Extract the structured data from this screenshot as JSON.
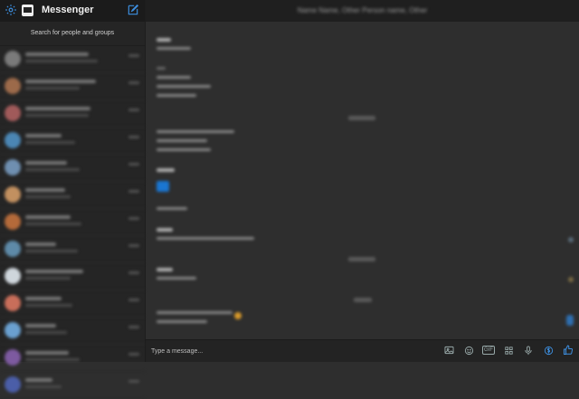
{
  "sidebar": {
    "title": "Messenger",
    "search_label": "Search for people and groups",
    "contacts": [
      {
        "avatar_color": "#7a7a7a",
        "name_w": 70,
        "prev_w": 80
      },
      {
        "avatar_color": "#9c6a4a",
        "name_w": 78,
        "prev_w": 60
      },
      {
        "avatar_color": "#a05a5a",
        "name_w": 72,
        "prev_w": 70
      },
      {
        "avatar_color": "#4b86b4",
        "name_w": 40,
        "prev_w": 55
      },
      {
        "avatar_color": "#6f8fb0",
        "name_w": 46,
        "prev_w": 60
      },
      {
        "avatar_color": "#c29060",
        "name_w": 44,
        "prev_w": 50
      },
      {
        "avatar_color": "#b46a3a",
        "name_w": 50,
        "prev_w": 62
      },
      {
        "avatar_color": "#5e8aa8",
        "name_w": 34,
        "prev_w": 58
      },
      {
        "avatar_color": "#cfd6dc",
        "name_w": 64,
        "prev_w": 50
      },
      {
        "avatar_color": "#c86e5a",
        "name_w": 40,
        "prev_w": 52
      },
      {
        "avatar_color": "#6aa0d0",
        "name_w": 34,
        "prev_w": 46
      },
      {
        "avatar_color": "#7d5aa0",
        "name_w": 48,
        "prev_w": 60
      },
      {
        "avatar_color": "#4b5ea8",
        "name_w": 30,
        "prev_w": 40
      }
    ]
  },
  "conversation": {
    "title": "Name Name, Other Person name, Other"
  },
  "composer": {
    "placeholder": "Type a message...",
    "gif_label": "GIF"
  },
  "colors": {
    "accent": "#3d8fe0",
    "sidebar_bg": "#252525",
    "main_bg": "#2e2e2e",
    "topbar_bg": "#1b1b1b"
  },
  "icons": {
    "settings": "gear-icon",
    "compose": "compose-icon",
    "photo": "photo-icon",
    "emoji": "emoji-icon",
    "gif": "gif-icon",
    "sticker": "sticker-icon",
    "mic": "microphone-icon",
    "payment": "payment-icon",
    "like": "thumbs-up-icon"
  }
}
